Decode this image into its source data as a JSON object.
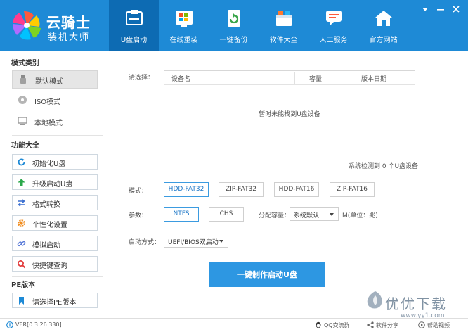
{
  "app": {
    "title": "云骑士",
    "subtitle": "装机大师"
  },
  "nav": {
    "items": [
      {
        "label": "U盘启动",
        "icon": "usb-icon"
      },
      {
        "label": "在线重装",
        "icon": "windows-icon"
      },
      {
        "label": "一键备份",
        "icon": "backup-icon"
      },
      {
        "label": "软件大全",
        "icon": "software-box-icon"
      },
      {
        "label": "人工服务",
        "icon": "chat-icon"
      },
      {
        "label": "官方网站",
        "icon": "home-icon"
      }
    ],
    "active_index": 0
  },
  "window_controls": {
    "menu_icon": "menu-arrow-icon",
    "minimize_icon": "minimize-icon",
    "close_icon": "close-icon"
  },
  "sidebar": {
    "mode_title": "模式类别",
    "modes": [
      {
        "label": "默认模式",
        "icon": "usb-drive-icon",
        "selected": true
      },
      {
        "label": "ISO模式",
        "icon": "disc-icon",
        "selected": false
      },
      {
        "label": "本地模式",
        "icon": "monitor-icon",
        "selected": false
      }
    ],
    "function_title": "功能大全",
    "functions": [
      {
        "label": "初始化U盘",
        "icon": "refresh-icon"
      },
      {
        "label": "升级启动U盘",
        "icon": "upgrade-arrow-icon"
      },
      {
        "label": "格式转换",
        "icon": "convert-icon"
      },
      {
        "label": "个性化设置",
        "icon": "gear-icon"
      },
      {
        "label": "模拟启动",
        "icon": "link-icon"
      },
      {
        "label": "快捷键查询",
        "icon": "search-icon"
      }
    ],
    "pe_title": "PE版本",
    "pe_button": {
      "label": "请选择PE版本",
      "icon": "bookmark-icon"
    }
  },
  "main": {
    "select_label": "请选择：",
    "table": {
      "columns": [
        "设备名",
        "容量",
        "版本日期"
      ],
      "empty_message": "暂时未能找到U盘设备"
    },
    "detect_status": "系统检测到 0 个U盘设备",
    "mode_label": "模式：",
    "mode_options": [
      "HDD-FAT32",
      "ZIP-FAT32",
      "HDD-FAT16",
      "ZIP-FAT16"
    ],
    "mode_selected": "HDD-FAT32",
    "param_label": "参数：",
    "param_options": [
      "NTFS",
      "CHS"
    ],
    "param_selected": "NTFS",
    "alloc_label": "分配容量：",
    "alloc_value": "系统默认",
    "alloc_unit": "M(单位：兆)",
    "boot_label": "启动方式：",
    "boot_value": "UEFI/BIOS双启动",
    "make_button": "一键制作启动U盘"
  },
  "footer": {
    "version": "VER[0.3.26.330]",
    "qq_group": "QQ交流群",
    "share": "软件分享",
    "help": "帮助视频"
  },
  "watermark": {
    "text": "优优下载",
    "url": "www.yy1.com"
  },
  "colors": {
    "header_bg": "#1e8ad6",
    "nav_active_bg": "#0d6bb3",
    "primary_button": "#2d97e2",
    "option_selected": "#3b9be0"
  }
}
